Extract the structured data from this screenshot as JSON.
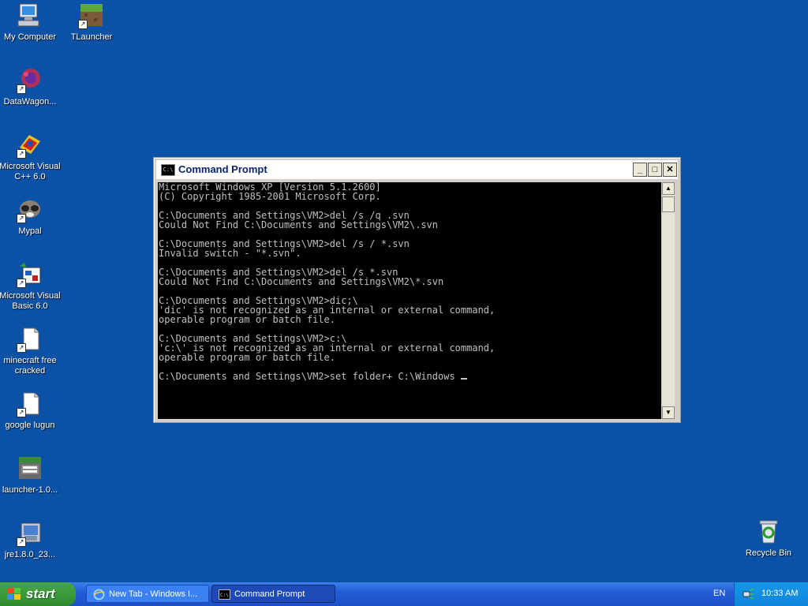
{
  "desktop": {
    "icons": [
      {
        "label": "My Computer"
      },
      {
        "label": "TLauncher"
      },
      {
        "label": "DataWagon..."
      },
      {
        "label": "Microsoft Visual C++ 6.0"
      },
      {
        "label": "Mypal"
      },
      {
        "label": "Microsoft Visual Basic 6.0"
      },
      {
        "label": "minecraft free cracked"
      },
      {
        "label": "google lugun"
      },
      {
        "label": "launcher-1.0..."
      },
      {
        "label": "jre1.8.0_23..."
      },
      {
        "label": "Recycle Bin"
      }
    ]
  },
  "window": {
    "title": "Command Prompt",
    "icon_text": "C:\\",
    "buttons": {
      "minimize": "_",
      "maximize": "□",
      "close": "✕"
    },
    "console_lines": [
      "Microsoft Windows XP [Version 5.1.2600]",
      "(C) Copyright 1985-2001 Microsoft Corp.",
      "",
      "C:\\Documents and Settings\\VM2>del /s /q .svn",
      "Could Not Find C:\\Documents and Settings\\VM2\\.svn",
      "",
      "C:\\Documents and Settings\\VM2>del /s / *.svn",
      "Invalid switch - \"*.svn\".",
      "",
      "C:\\Documents and Settings\\VM2>del /s *.svn",
      "Could Not Find C:\\Documents and Settings\\VM2\\*.svn",
      "",
      "C:\\Documents and Settings\\VM2>dic;\\",
      "'dic' is not recognized as an internal or external command,",
      "operable program or batch file.",
      "",
      "C:\\Documents and Settings\\VM2>c:\\",
      "'c:\\' is not recognized as an internal or external command,",
      "operable program or batch file.",
      ""
    ],
    "current_line": "C:\\Documents and Settings\\VM2>set folder+ C:\\Windows "
  },
  "taskbar": {
    "start_label": "start",
    "tasks": [
      {
        "label": "New Tab - Windows I..."
      },
      {
        "label": "Command Prompt"
      }
    ],
    "language": "EN",
    "clock": "10:33 AM"
  },
  "colors": {
    "desktop": "#0b52a6",
    "console_bg": "#000000",
    "console_fg": "#c0c0c0",
    "taskbar": "#245dd7",
    "start_button": "#3a9c3a"
  }
}
